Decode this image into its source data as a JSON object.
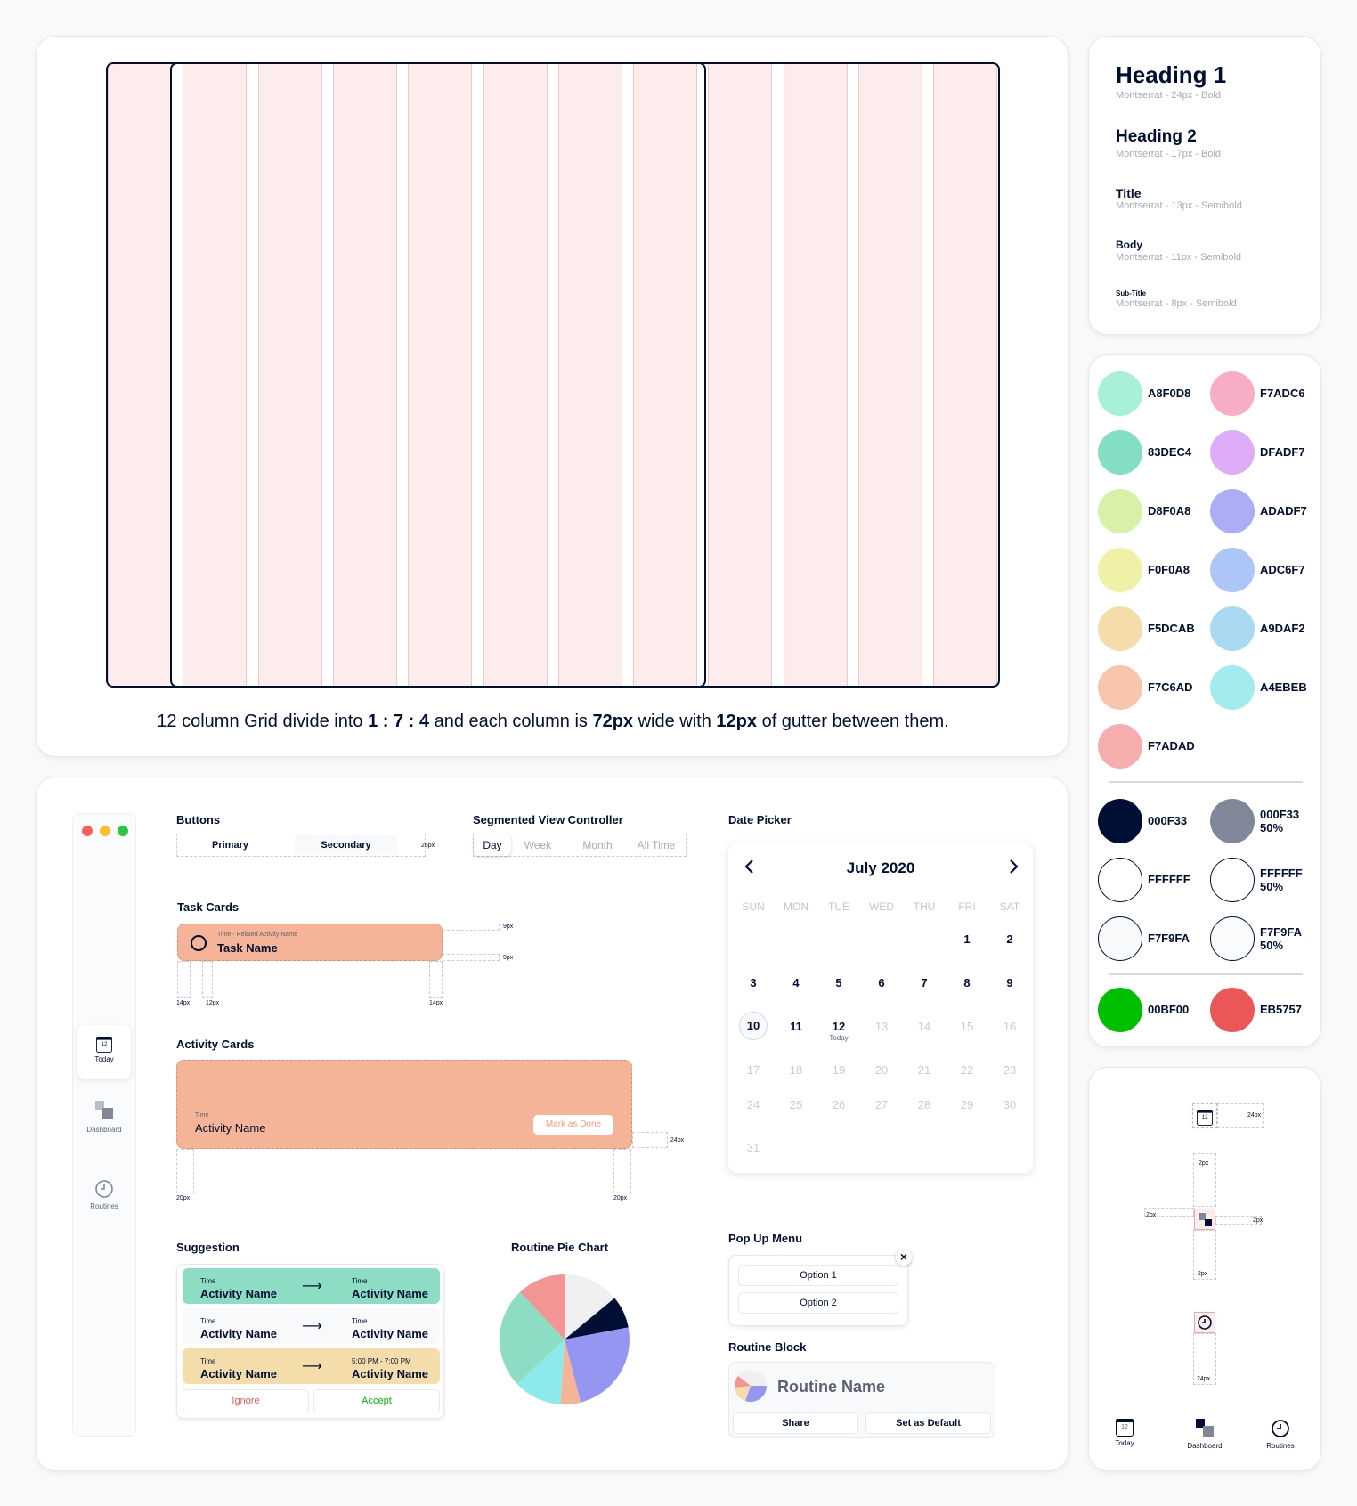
{
  "grid": {
    "caption_parts": [
      "12 column Grid divide into ",
      "1 : 7 : 4",
      " and each column is ",
      "72px",
      " wide with ",
      "12px",
      " of gutter between them."
    ]
  },
  "typography": [
    {
      "name": "Heading 1",
      "spec": "Montserrat - 24px - Bold"
    },
    {
      "name": "Heading 2",
      "spec": "Montserrat - 17px - Bold"
    },
    {
      "name": "Title",
      "spec": "Montserrat - 13px - Semibold"
    },
    {
      "name": "Body",
      "spec": "Montserrat - 11px - Semibold"
    },
    {
      "name": "Sub-Title",
      "spec": "Montserrat - 8px - Semibold"
    }
  ],
  "palette": {
    "swatches": [
      {
        "label": "A8F0D8",
        "color": "#A8F0D8"
      },
      {
        "label": "F7ADC6",
        "color": "#F7ADC6"
      },
      {
        "label": "83DEC4",
        "color": "#83DEC4"
      },
      {
        "label": "DFADF7",
        "color": "#DFADF7"
      },
      {
        "label": "D8F0A8",
        "color": "#D8F0A8"
      },
      {
        "label": "ADADF7",
        "color": "#ADADF7"
      },
      {
        "label": "F0F0A8",
        "color": "#F0F0A8"
      },
      {
        "label": "ADC6F7",
        "color": "#ADC6F7"
      },
      {
        "label": "F5DCAB",
        "color": "#F5DCAB"
      },
      {
        "label": "A9DAF2",
        "color": "#A9DAF2"
      },
      {
        "label": "F7C6AD",
        "color": "#F7C6AD"
      },
      {
        "label": "A4EBEB",
        "color": "#A4EBEB"
      },
      {
        "label": "F7ADAD",
        "color": "#F7ADAD"
      }
    ],
    "neutrals": [
      {
        "label": "000F33",
        "sub": "",
        "color": "#000F33"
      },
      {
        "label": "000F33",
        "sub": "50%",
        "color": "#7f8799"
      },
      {
        "label": "FFFFFF",
        "sub": "",
        "color": "#FFFFFF"
      },
      {
        "label": "FFFFFF",
        "sub": "50%",
        "color": "#FFFFFF"
      },
      {
        "label": "F7F9FA",
        "sub": "",
        "color": "#F7F9FA"
      },
      {
        "label": "F7F9FA",
        "sub": "50%",
        "color": "#FBFCFD"
      }
    ],
    "status": [
      {
        "label": "00BF00",
        "color": "#00BF00"
      },
      {
        "label": "EB5757",
        "color": "#EB5757"
      }
    ]
  },
  "components": {
    "nav": {
      "today": "Today",
      "today_day": "12",
      "dashboard": "Dashboard",
      "routines": "Routines"
    },
    "buttons": {
      "title": "Buttons",
      "primary": "Primary",
      "secondary": "Secondary",
      "height_note": "26px"
    },
    "segmented": {
      "title": "Segmented View Controller",
      "options": [
        "Day",
        "Week",
        "Month",
        "All Time"
      ]
    },
    "task_cards": {
      "title": "Task Cards",
      "time": "Time - Related Activity Name",
      "name": "Task Name",
      "m1": "9px",
      "m2": "9px",
      "m3": "14px",
      "m4": "12px",
      "m5": "14px"
    },
    "activity_cards": {
      "title": "Activity Cards",
      "time": "Time",
      "name": "Activity Name",
      "action": "Mark as Done",
      "m1": "24px",
      "m2": "20px",
      "m3": "20px"
    },
    "suggestion": {
      "title": "Suggestion",
      "rows": [
        {
          "t1": "Time",
          "n1": "Activity Name",
          "t2": "Time",
          "n2": "Activity Name"
        },
        {
          "t1": "Time",
          "n1": "Activity Name",
          "t2": "Time",
          "n2": "Activity Name"
        },
        {
          "t1": "Time",
          "n1": "Activity Name",
          "t2": "5:00 PM - 7:00 PM",
          "n2": "Activity Name"
        }
      ],
      "arrow": "⟶",
      "ignore": "Ignore",
      "accept": "Accept"
    },
    "pie": {
      "title": "Routine Pie Chart"
    },
    "date_picker": {
      "title": "Date Picker",
      "month": "July 2020",
      "weekdays": [
        "SUN",
        "MON",
        "TUE",
        "WED",
        "THU",
        "FRI",
        "SAT"
      ],
      "today_label": "Today"
    },
    "popup": {
      "title": "Pop Up Menu",
      "options": [
        "Option 1",
        "Option 2"
      ],
      "close": "×"
    },
    "routine_block": {
      "title": "Routine Block",
      "name": "Routine Name",
      "share": "Share",
      "default": "Set as Default"
    }
  },
  "icons_spec": {
    "labels": [
      "24px",
      "2px",
      "2px",
      "2px",
      "2px",
      "24px"
    ],
    "day": "12",
    "nav": {
      "today": "Today",
      "dashboard": "Dashboard",
      "routines": "Routines"
    }
  },
  "chart_data": {
    "type": "pie",
    "title": "Routine Pie Chart",
    "slices": [
      {
        "value": 14,
        "color": "#F0F0F0"
      },
      {
        "value": 8,
        "color": "#000F33"
      },
      {
        "value": 24,
        "color": "#9595F2"
      },
      {
        "value": 5,
        "color": "#F5B497"
      },
      {
        "value": 12,
        "color": "#8CEAEA"
      },
      {
        "value": 25,
        "color": "#8CDDC4"
      },
      {
        "value": 12,
        "color": "#F39595"
      }
    ]
  },
  "calendar_grid": [
    [
      "",
      "",
      "",
      "",
      "",
      "1",
      "2"
    ],
    [
      "3",
      "4",
      "5",
      "6",
      "7",
      "8",
      "9"
    ],
    [
      "10",
      "11",
      "12",
      "13",
      "14",
      "15",
      "16"
    ],
    [
      "17",
      "18",
      "19",
      "20",
      "21",
      "22",
      "23"
    ],
    [
      "24",
      "25",
      "26",
      "27",
      "28",
      "29",
      "30"
    ],
    [
      "31",
      "",
      "",
      "",
      "",
      "",
      ""
    ]
  ]
}
